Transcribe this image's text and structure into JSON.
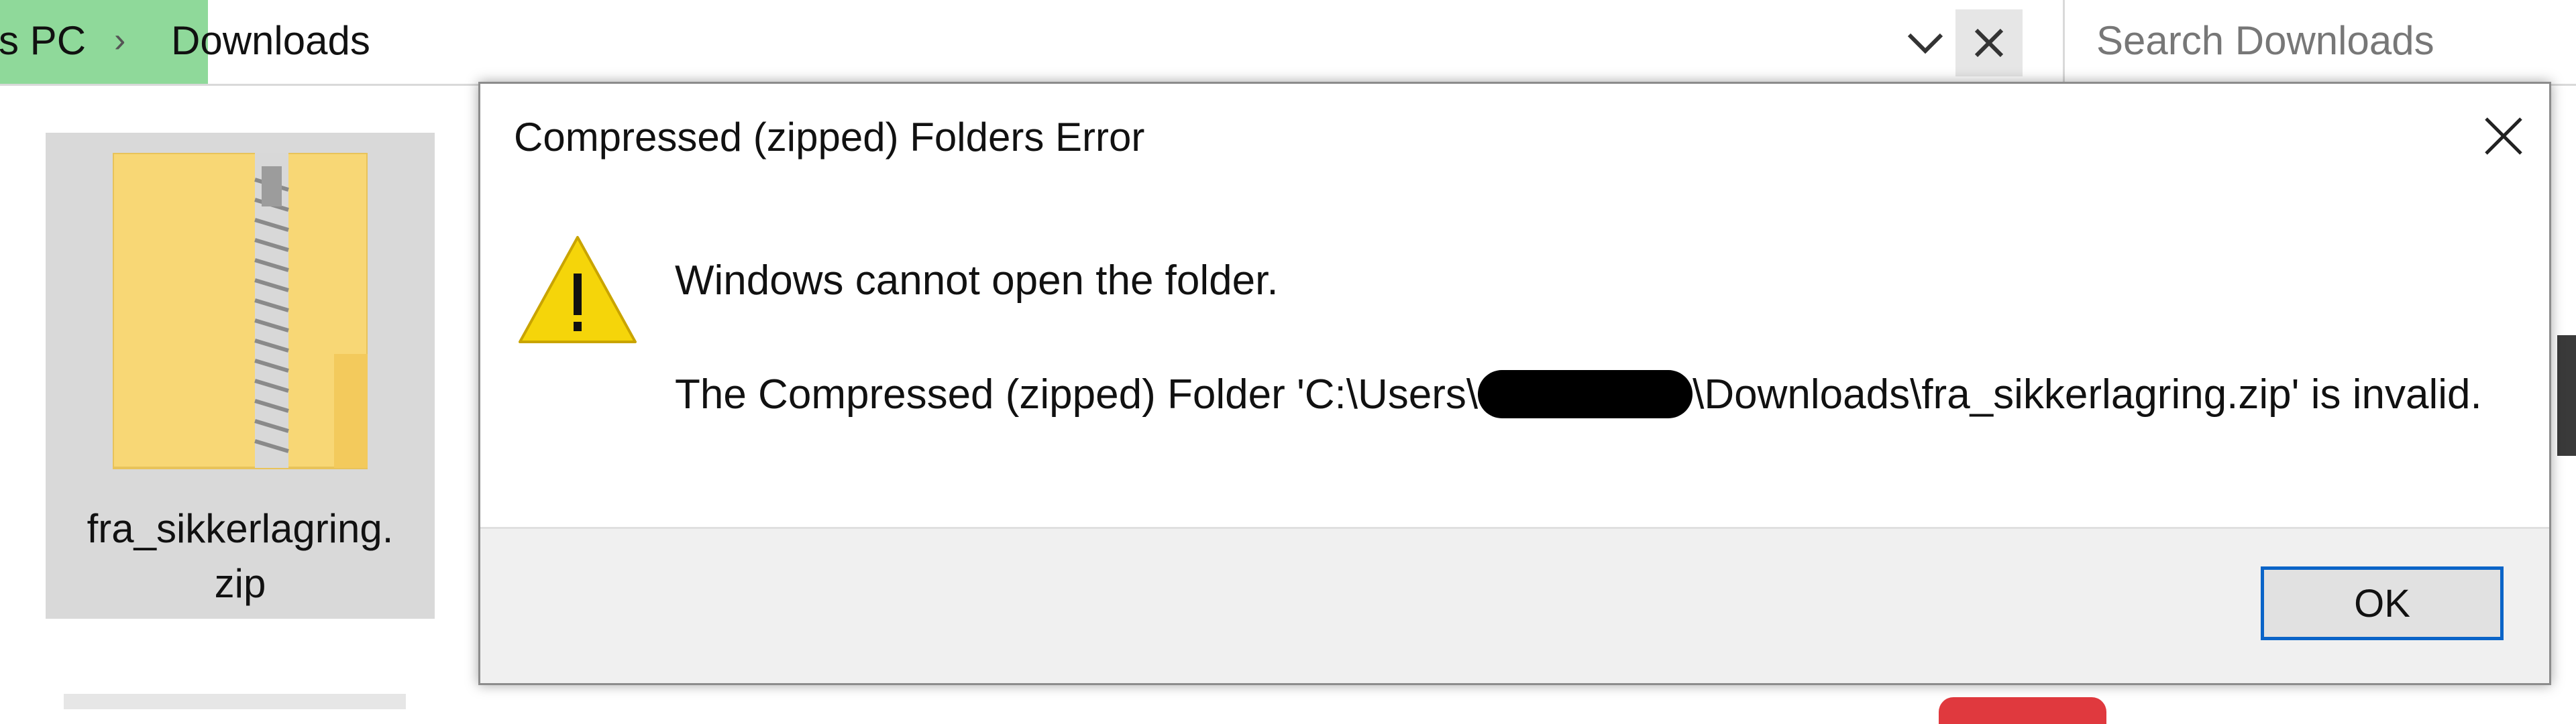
{
  "explorer": {
    "breadcrumb": {
      "pc": "s PC",
      "separator": "›",
      "folder": "Downloads"
    },
    "search": {
      "placeholder": "Search Downloads"
    },
    "file": {
      "name_line1": "fra_sikkerlagring.",
      "name_line2": "zip",
      "icon": "zip-folder-icon"
    }
  },
  "dialog": {
    "title": "Compressed (zipped) Folders Error",
    "main_message": "Windows cannot open the folder.",
    "detail_prefix": "The Compressed (zipped) Folder 'C:\\Users\\",
    "detail_suffix": "\\Downloads\\fra_sikkerlagring.zip' is invalid.",
    "ok_label": "OK",
    "icons": {
      "warning": "warning-icon",
      "close": "close-icon"
    },
    "colors": {
      "ok_border": "#0a64c8",
      "warning_fill": "#f5d50a"
    }
  }
}
